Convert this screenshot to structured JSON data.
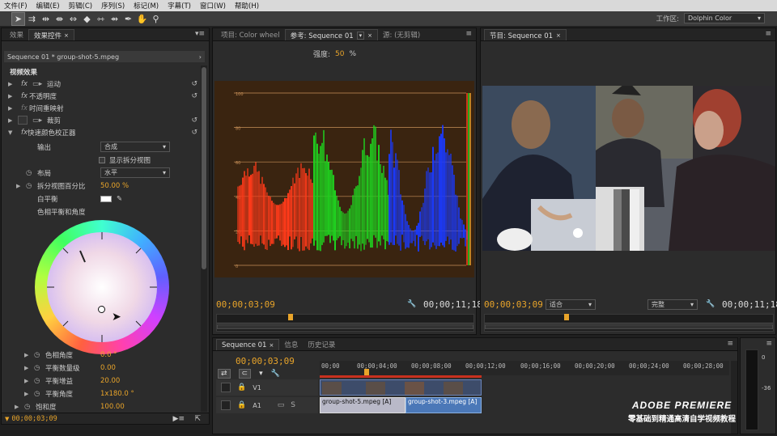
{
  "menu": [
    "文件(F)",
    "编辑(E)",
    "剪辑(C)",
    "序列(S)",
    "标记(M)",
    "字幕(T)",
    "窗口(W)",
    "帮助(H)"
  ],
  "toolbar": {
    "tools": [
      "selection-tool",
      "track-select-tool",
      "ripple-edit-tool",
      "rolling-edit-tool",
      "rate-stretch-tool",
      "razor-tool",
      "slip-tool",
      "slide-tool",
      "pen-tool",
      "hand-tool",
      "zoom-tool"
    ],
    "tool_glyphs": [
      "➤",
      "⇉",
      "⇹",
      "⇼",
      "⇔",
      "◆",
      "⇿",
      "⇴",
      "✒",
      "✋",
      "⚲"
    ],
    "workspace_label": "工作区:",
    "workspace_value": "Dolphin Color"
  },
  "effect_controls": {
    "tabs": [
      "效果",
      "效果控件"
    ],
    "clip_header": "Sequence 01 * group-shot-5.mpeg",
    "section": "视频效果",
    "effects": [
      {
        "label": "运动",
        "fx": "fx"
      },
      {
        "label": "不透明度",
        "fx": "fx"
      },
      {
        "label": "时间重映射",
        "fx": "fx"
      },
      {
        "label": "裁剪",
        "fx": "fx"
      },
      {
        "label": "快速颜色校正器",
        "fx": "fx"
      }
    ],
    "output_label": "输出",
    "output_value": "合成",
    "split_view_label": "显示拆分视图",
    "layout_label": "布局",
    "layout_value": "水平",
    "split_percent_label": "拆分视图百分比",
    "split_percent_value": "50.00 %",
    "white_balance_label": "白平衡",
    "hue_balance_label": "色相平衡和角度",
    "params": [
      {
        "label": "色相角度",
        "value": "0.0 °"
      },
      {
        "label": "平衡数量级",
        "value": "0.00"
      },
      {
        "label": "平衡增益",
        "value": "20.00"
      },
      {
        "label": "平衡角度",
        "value": "1x180.0 °"
      },
      {
        "label": "饱和度",
        "value": "100.00"
      }
    ],
    "timecode": "00;00;03;09"
  },
  "source_monitor": {
    "tabs": [
      "项目: Color wheel",
      "参考: Sequence 01",
      "源: (无剪辑)"
    ],
    "intensity_label": "强度:",
    "intensity_value": "50",
    "intensity_unit": "%",
    "scale_ticks": [
      "100",
      "80",
      "60",
      "40",
      "20",
      "0"
    ],
    "timecode_left": "00;00;03;09",
    "timecode_right": "00;00;11;18"
  },
  "program_monitor": {
    "tab": "节目: Sequence 01",
    "fit_value": "适合",
    "quality_value": "完整",
    "timecode_left": "00;00;03;09",
    "timecode_right": "00;00;11;18"
  },
  "timeline": {
    "tabs": [
      "Sequence 01",
      "信息",
      "历史记录"
    ],
    "timecode": "00;00;03;09",
    "ruler": [
      "00;00",
      "00;00;04;00",
      "00;00;08;00",
      "00;00;12;00",
      "00;00;16;00",
      "00;00;20;00",
      "00;00;24;00",
      "00;00;28;00"
    ],
    "tracks": [
      "V1",
      "A1"
    ],
    "audio_clips": [
      "group-shot-5.mpeg [A]",
      "group-shot-3.mpeg [A]"
    ]
  },
  "audio_meter": {
    "labels": [
      "0",
      "-36"
    ]
  },
  "watermark": {
    "line1": "ADOBE PREMIERE",
    "line2": "零基础到精通高清自学视频教程"
  },
  "colors": {
    "accent": "#e8a42a",
    "red": "#ff3a1a",
    "green": "#1fd21f",
    "blue": "#1a3aff",
    "clip_blue": "#4b78b8",
    "panel": "#2c2c2c"
  }
}
